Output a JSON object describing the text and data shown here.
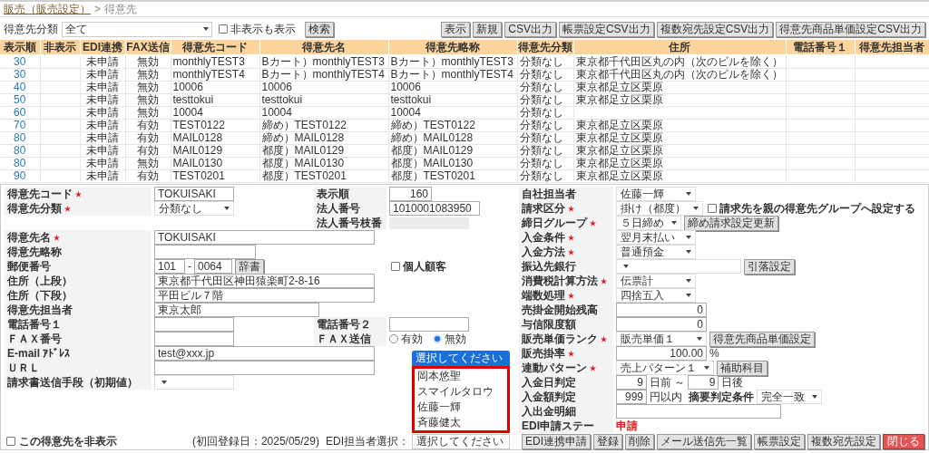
{
  "breadcrumb": {
    "parent": "販売（販売設定）",
    "separator": ">",
    "current": "得意先"
  },
  "filter": {
    "label": "得意先分類",
    "value": "全て",
    "show_hidden": {
      "label": "非表示も表示",
      "checked": false
    },
    "search_button": "検索"
  },
  "toolbar_buttons": [
    "表示",
    "新規",
    "CSV出力",
    "帳票設定CSV出力",
    "複数宛先設定CSV出力",
    "得意先商品単価設定CSV出力"
  ],
  "table": {
    "columns": [
      "表示順",
      "非表示",
      "EDI連携",
      "FAX送信",
      "得意先コード",
      "得意先名",
      "得意先略称",
      "得意先分類",
      "住所",
      "電話番号１",
      "得意先担当者"
    ],
    "rows": [
      [
        "30",
        "",
        "未申請",
        "無効",
        "monthlyTEST3",
        "Bカート）monthlyTEST3",
        "Bカート）monthlyTEST3",
        "分類なし",
        "東京都千代田区丸の内（次のビルを除く）",
        "",
        ""
      ],
      [
        "30",
        "",
        "未申請",
        "無効",
        "monthlyTEST4",
        "Bカート）monthlyTEST4",
        "Bカート）monthlyTEST4",
        "分類なし",
        "東京都千代田区丸の内（次のビルを除く）",
        "",
        ""
      ],
      [
        "40",
        "",
        "未申請",
        "無効",
        "10006",
        "10006",
        "10006",
        "分類なし",
        "東京都足立区栗原",
        "",
        ""
      ],
      [
        "50",
        "",
        "未申請",
        "無効",
        "testtokui",
        "testtokui",
        "testtokui",
        "分類なし",
        "東京都足立区栗原",
        "",
        ""
      ],
      [
        "60",
        "",
        "未申請",
        "無効",
        "10004",
        "10004",
        "10004",
        "分類なし",
        "",
        "",
        ""
      ],
      [
        "70",
        "",
        "未申請",
        "有効",
        "TEST0122",
        "締め）TEST0122",
        "締め）TEST0122",
        "分類なし",
        "東京都足立区栗原",
        "",
        ""
      ],
      [
        "80",
        "",
        "未申請",
        "有効",
        "MAIL0128",
        "締め）MAIL0128",
        "締め）MAIL0128",
        "分類なし",
        "東京都足立区栗原",
        "",
        ""
      ],
      [
        "80",
        "",
        "未申請",
        "有効",
        "MAIL0129",
        "都度）MAIL0129",
        "都度）MAIL0129",
        "分類なし",
        "東京都足立区栗原",
        "",
        ""
      ],
      [
        "80",
        "",
        "未申請",
        "無効",
        "MAIL0130",
        "都度）MAIL0130",
        "都度）MAIL0130",
        "分類なし",
        "東京都足立区栗原",
        "",
        ""
      ],
      [
        "90",
        "",
        "未申請",
        "有効",
        "TEST0201",
        "都度）TEST0201",
        "都度）TEST0201",
        "分類なし",
        "東京都足立区栗原",
        "",
        ""
      ]
    ]
  },
  "form": {
    "rows": [
      {
        "left": {
          "label": "得意先コード",
          "required": true,
          "controls": [
            {
              "kind": "text",
              "value": "TOKUISAKI"
            }
          ]
        },
        "middle": {
          "label": "表示順",
          "required": false,
          "controls": [
            {
              "kind": "number",
              "value": "160"
            }
          ]
        },
        "right": {
          "label": "自社担当者",
          "required": false,
          "controls": [
            {
              "kind": "select",
              "value": "佐藤一輝"
            }
          ]
        }
      },
      {
        "left": {
          "label": "得意先分類",
          "required": true,
          "controls": [
            {
              "kind": "select",
              "value": "分類なし"
            }
          ]
        },
        "middle": {
          "label": "法人番号",
          "required": false,
          "controls": [
            {
              "kind": "text",
              "value": "1010001083950"
            }
          ]
        },
        "right": {
          "label": "請求区分",
          "required": true,
          "controls": [
            {
              "kind": "select",
              "value": "掛け（都度）"
            },
            {
              "kind": "checkbox",
              "label": "請求先を親の得意先グループへ設定する",
              "checked": false
            }
          ]
        }
      },
      {
        "middle": {
          "label": "法人番号枝番",
          "required": false,
          "controls": [
            {
              "kind": "readonly"
            }
          ]
        },
        "right": {
          "label": "締日グループ",
          "required": true,
          "controls": [
            {
              "kind": "select",
              "value": "５日締め"
            },
            {
              "kind": "button",
              "label": "締め請求設定更新"
            }
          ]
        }
      },
      {
        "left": {
          "label": "得意先名",
          "required": true,
          "controls": [
            {
              "kind": "text",
              "value": "TOKUISAKI"
            }
          ]
        },
        "right": {
          "label": "入金条件",
          "required": true,
          "controls": [
            {
              "kind": "select",
              "value": "翌月末払い"
            }
          ]
        }
      },
      {
        "left": {
          "label": "得意先略称",
          "required": false,
          "controls": [
            {
              "kind": "text"
            }
          ]
        },
        "right": {
          "label": "入金方法",
          "required": true,
          "controls": [
            {
              "kind": "select",
              "value": "普通預金"
            }
          ]
        }
      },
      {
        "left": {
          "label": "郵便番号",
          "required": false,
          "controls": [
            {
              "kind": "text",
              "value": "101"
            },
            {
              "kind": "note",
              "label": "-"
            },
            {
              "kind": "text",
              "value": "0064"
            },
            {
              "kind": "button",
              "label": "辞書"
            }
          ]
        },
        "middle": {
          "controls": [
            {
              "kind": "checkbox",
              "label": "個人顧客",
              "checked": false
            }
          ]
        },
        "right": {
          "label": "振込先銀行",
          "required": false,
          "controls": [
            {
              "kind": "select"
            },
            {
              "kind": "button",
              "label": "引落設定"
            }
          ]
        }
      },
      {
        "left": {
          "label": "住所（上段）",
          "required": false,
          "controls": [
            {
              "kind": "text",
              "value": "東京都千代田区神田猿楽町2-8-16"
            }
          ]
        },
        "right": {
          "label": "消費税計算方法",
          "required": true,
          "controls": [
            {
              "kind": "select",
              "value": "伝票計"
            }
          ]
        }
      },
      {
        "left": {
          "label": "住所（下段）",
          "required": false,
          "controls": [
            {
              "kind": "text",
              "value": "平田ビル７階"
            }
          ]
        },
        "right": {
          "label": "端数処理",
          "required": true,
          "controls": [
            {
              "kind": "select",
              "value": "四捨五入"
            }
          ]
        }
      },
      {
        "left": {
          "label": "得意先担当者",
          "required": false,
          "controls": [
            {
              "kind": "text",
              "value": "東京太郎"
            }
          ]
        },
        "right": {
          "label": "売掛金開始残高",
          "required": false,
          "controls": [
            {
              "kind": "number",
              "value": "0"
            }
          ]
        }
      },
      {
        "left": {
          "label": "電話番号１",
          "required": false,
          "controls": [
            {
              "kind": "text"
            }
          ]
        },
        "middle": {
          "label": "電話番号２",
          "required": false,
          "controls": [
            {
              "kind": "text"
            }
          ]
        },
        "right": {
          "label": "与信限度額",
          "required": false,
          "controls": [
            {
              "kind": "number",
              "value": "0"
            }
          ]
        }
      },
      {
        "left": {
          "label": "ＦＡＸ番号",
          "required": false,
          "controls": [
            {
              "kind": "text"
            }
          ]
        },
        "middle": {
          "label": "ＦＡＸ送信",
          "required": false,
          "controls": [
            {
              "kind": "radio",
              "label": "有効",
              "selected": false
            },
            {
              "kind": "radio",
              "label": "無効",
              "selected": true
            }
          ]
        },
        "right": {
          "label": "販売単価ランク",
          "required": true,
          "controls": [
            {
              "kind": "select",
              "value": "販売単価１"
            },
            {
              "kind": "button",
              "label": "得意先商品単価設定"
            }
          ]
        }
      },
      {
        "left": {
          "label": "E-mail ｱﾄﾞﾚｽ",
          "required": false,
          "controls": [
            {
              "kind": "text",
              "value": "test@xxx.jp"
            }
          ]
        },
        "right": {
          "label": "販売掛率",
          "required": true,
          "controls": [
            {
              "kind": "number",
              "value": "100.00"
            },
            {
              "kind": "note",
              "label": "%"
            }
          ]
        }
      },
      {
        "left": {
          "label": "ＵＲＬ",
          "required": false,
          "controls": [
            {
              "kind": "text"
            }
          ]
        },
        "right": {
          "label": "連動パターン",
          "required": true,
          "controls": [
            {
              "kind": "select",
              "value": "売上パターン１"
            },
            {
              "kind": "button",
              "label": "補助科目"
            }
          ]
        }
      },
      {
        "left": {
          "label": "請求書送信手段（初期値）",
          "required": false,
          "controls": [
            {
              "kind": "select"
            }
          ]
        },
        "right": {
          "label": "入金日判定",
          "required": false,
          "controls": [
            {
              "kind": "number",
              "value": "9"
            },
            {
              "kind": "note",
              "label": "日前 ～"
            },
            {
              "kind": "number",
              "value": "9"
            },
            {
              "kind": "note",
              "label": "日後"
            }
          ]
        }
      },
      {
        "right": {
          "label": "入金額判定",
          "required": false,
          "controls": [
            {
              "kind": "number",
              "value": "999"
            },
            {
              "kind": "note",
              "label": "円以内"
            },
            {
              "kind": "sublabel",
              "label": "摘要判定条件"
            },
            {
              "kind": "select",
              "value": "完全一致"
            }
          ]
        }
      },
      {
        "right": {
          "label": "入出金明細",
          "required": false,
          "controls": [
            {
              "kind": "text"
            }
          ]
        }
      },
      {
        "right": {
          "label": "EDI申請ステー",
          "required": false,
          "controls": [
            {
              "kind": "status",
              "label": "申請"
            }
          ]
        }
      }
    ]
  },
  "footer": {
    "hide_checkbox": {
      "label": "この得意先を非表示",
      "checked": false
    },
    "registered": "(初回登録日：2025/05/29)",
    "edi_label": "EDI担当者選択：",
    "edi_select": "選択してください",
    "buttons": [
      {
        "label": "EDI連携申請",
        "kind": "default"
      },
      {
        "label": "登録",
        "kind": "default"
      },
      {
        "label": "削除",
        "kind": "default"
      },
      {
        "label": "メール送信先一覧",
        "kind": "default"
      },
      {
        "label": "帳票設定",
        "kind": "default"
      },
      {
        "label": "複数宛先設定",
        "kind": "default"
      },
      {
        "label": "閉じる",
        "kind": "danger"
      }
    ]
  },
  "dropdown": {
    "highlighted": true,
    "options": [
      {
        "label": "選択してください",
        "selected": true
      },
      {
        "label": "岡本悠聖",
        "selected": false
      },
      {
        "label": "スマイルタロウ",
        "selected": false
      },
      {
        "label": "佐藤一輝",
        "selected": false
      },
      {
        "label": "斉藤健太",
        "selected": false
      }
    ]
  }
}
